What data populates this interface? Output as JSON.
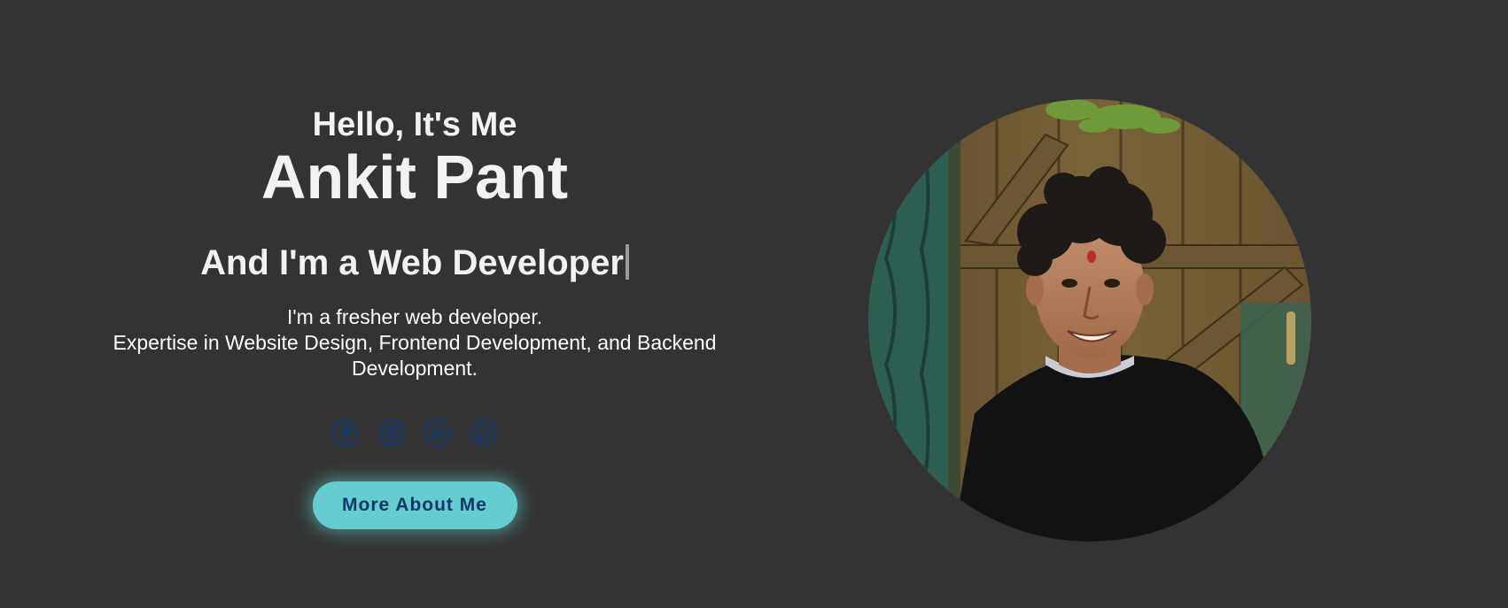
{
  "hero": {
    "greeting": "Hello, It's Me",
    "name": "Ankit Pant",
    "role": "And I'm a Web Developer",
    "description_line1": "I'm a fresher web developer.",
    "description_line2": "Expertise in Website Design, Frontend Development, and Backend Development.",
    "button_label": "More About Me"
  },
  "socials": [
    {
      "icon": "facebook-icon"
    },
    {
      "icon": "instagram-icon"
    },
    {
      "icon": "linkedin-icon"
    },
    {
      "icon": "github-icon"
    }
  ],
  "colors": {
    "background": "#333333",
    "text": "#f2f2f2",
    "accent": "#63cdd0",
    "icon": "#0d3a78",
    "button_text": "#12356b"
  }
}
